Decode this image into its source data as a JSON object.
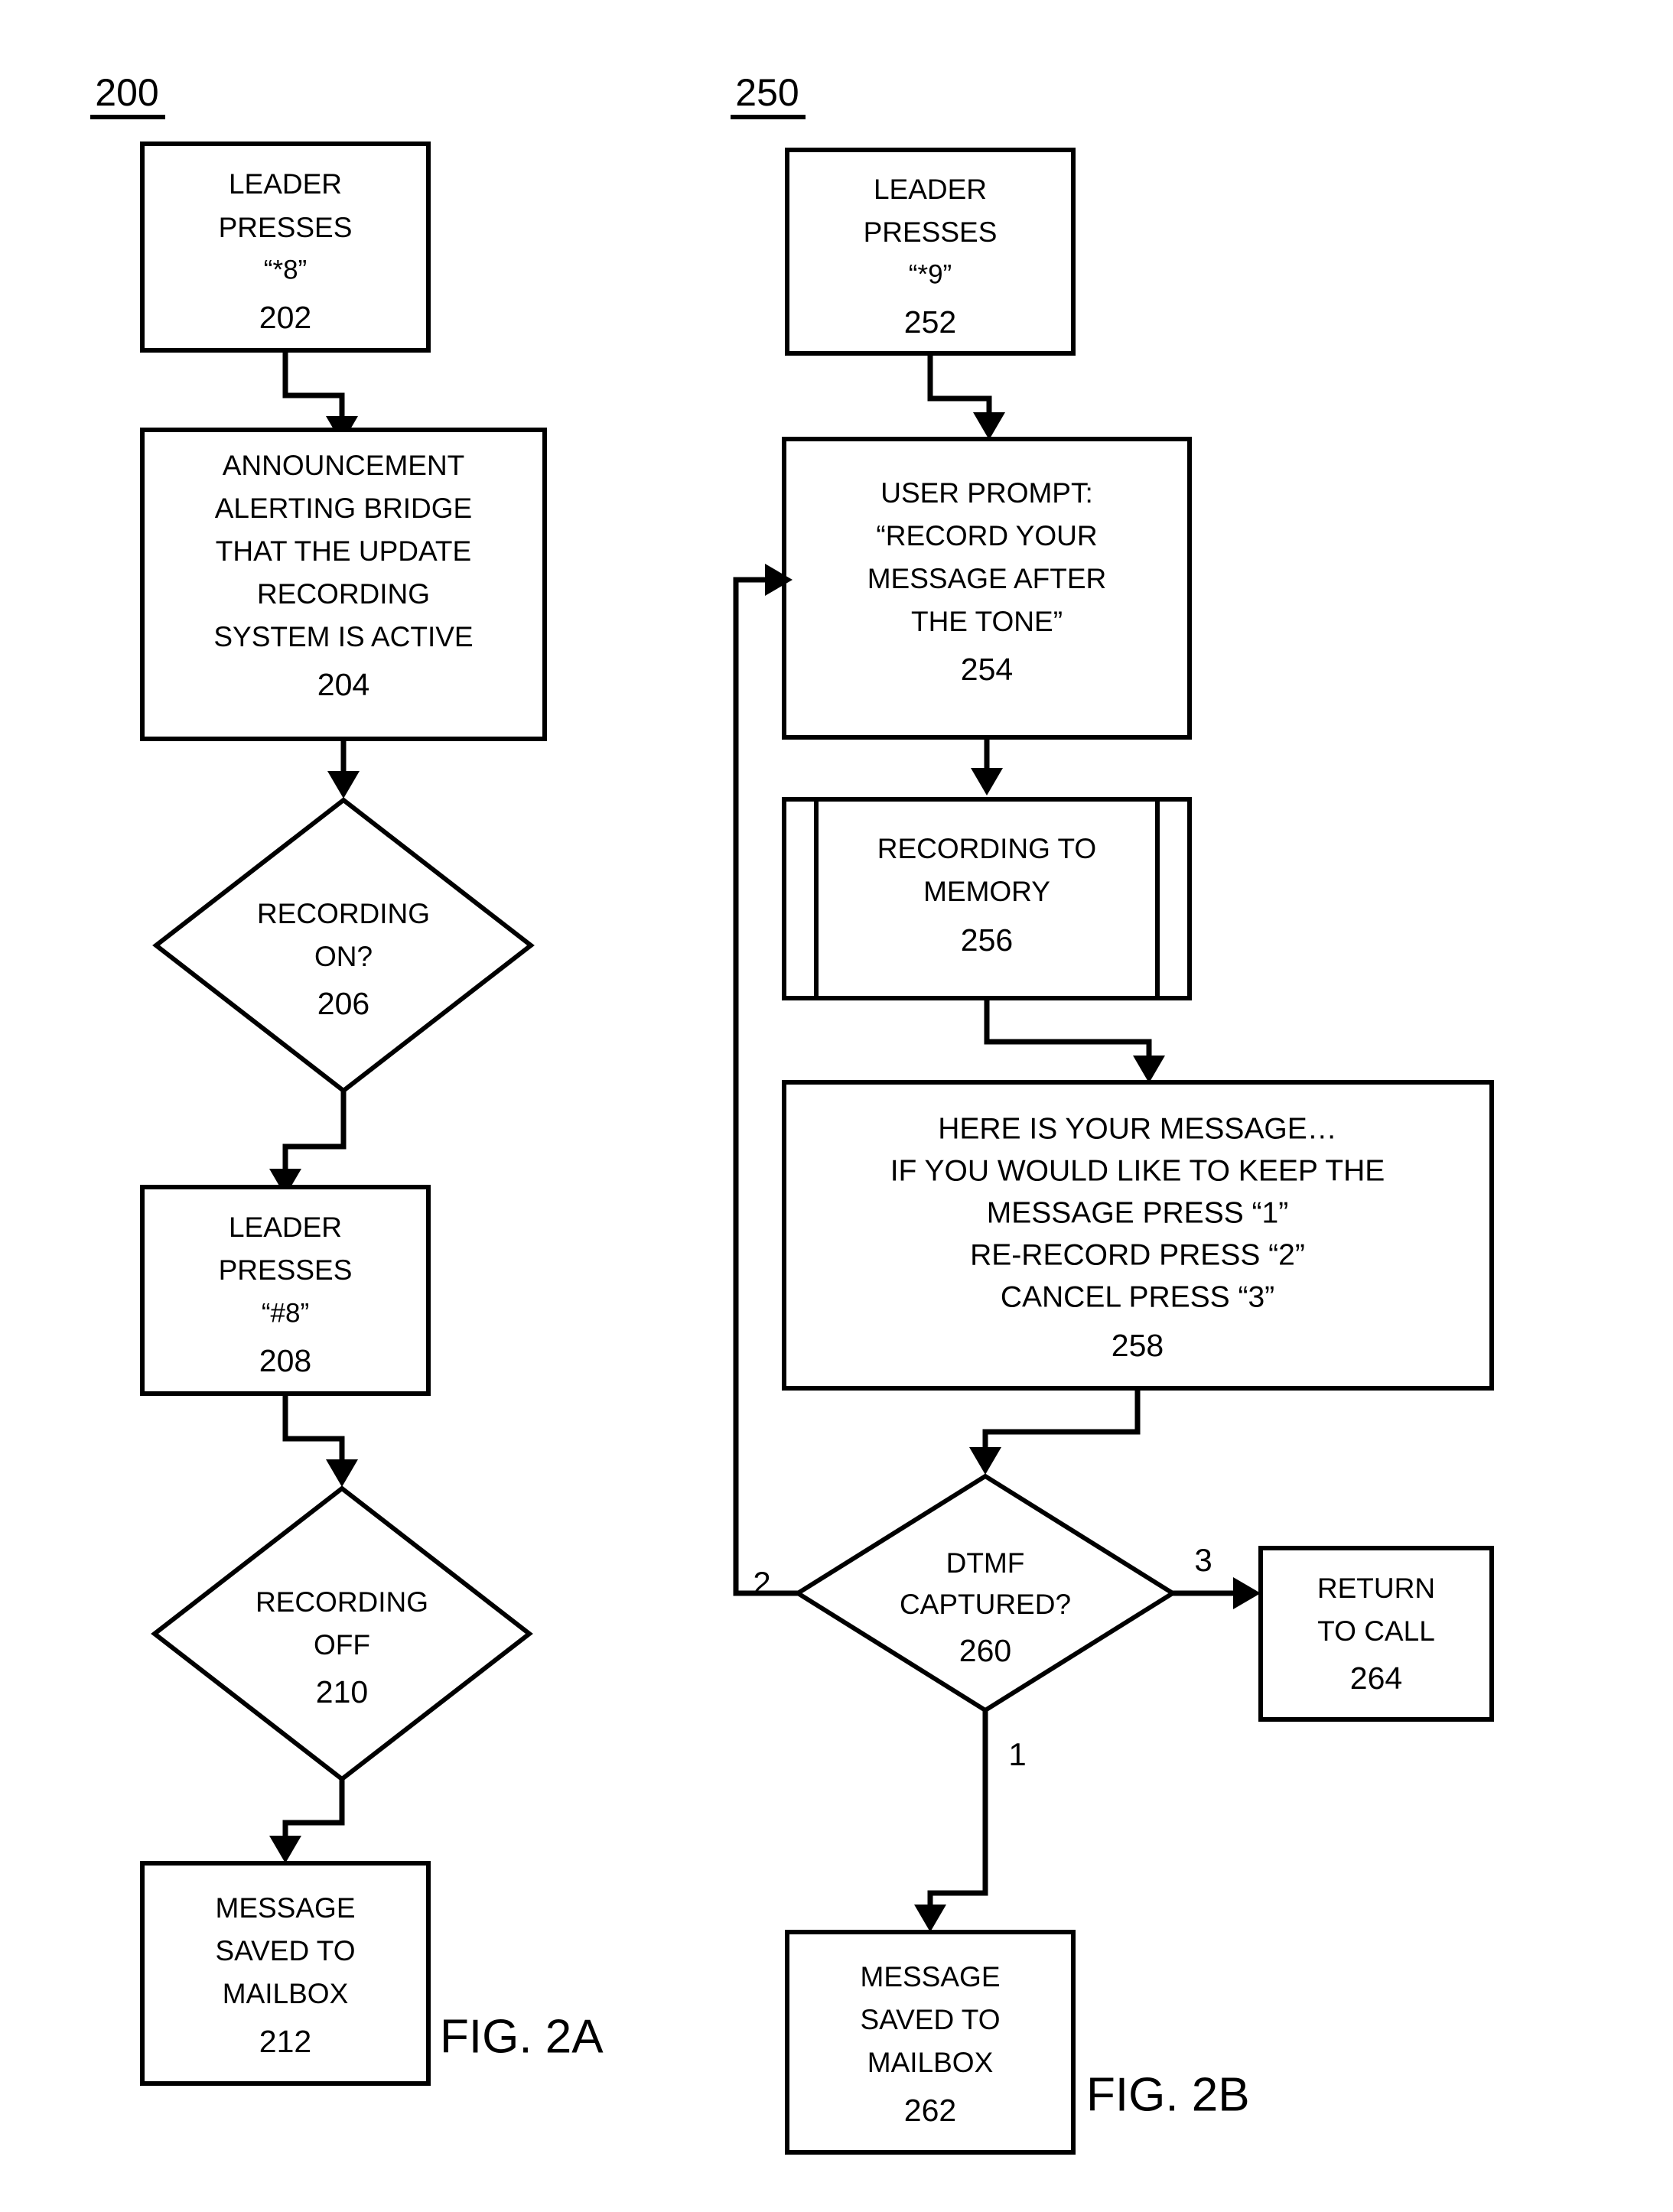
{
  "figures": [
    {
      "id": "fig-2a",
      "ref_label": "200",
      "caption": "FIG. 2A",
      "nodes": [
        {
          "id": "202",
          "shape": "process",
          "lines": [
            "LEADER",
            "PRESSES",
            "“*8”"
          ],
          "ref": "202"
        },
        {
          "id": "204",
          "shape": "process",
          "lines": [
            "ANNOUNCEMENT",
            "ALERTING BRIDGE",
            "THAT THE UPDATE",
            "RECORDING",
            "SYSTEM IS ACTIVE"
          ],
          "ref": "204"
        },
        {
          "id": "206",
          "shape": "decision",
          "lines": [
            "RECORDING",
            "ON?"
          ],
          "ref": "206"
        },
        {
          "id": "208",
          "shape": "process",
          "lines": [
            "LEADER",
            "PRESSES",
            "“#8”"
          ],
          "ref": "208"
        },
        {
          "id": "210",
          "shape": "decision",
          "lines": [
            "RECORDING",
            "OFF"
          ],
          "ref": "210"
        },
        {
          "id": "212",
          "shape": "process",
          "lines": [
            "MESSAGE",
            "SAVED TO",
            "MAILBOX"
          ],
          "ref": "212"
        }
      ],
      "edge_labels": []
    },
    {
      "id": "fig-2b",
      "ref_label": "250",
      "caption": "FIG. 2B",
      "nodes": [
        {
          "id": "252",
          "shape": "process",
          "lines": [
            "LEADER",
            "PRESSES",
            "“*9”"
          ],
          "ref": "252"
        },
        {
          "id": "254",
          "shape": "process",
          "lines": [
            "USER PROMPT:",
            "“RECORD YOUR",
            "MESSAGE AFTER",
            "THE TONE”"
          ],
          "ref": "254"
        },
        {
          "id": "256",
          "shape": "predefined-process",
          "lines": [
            "RECORDING TO",
            "MEMORY"
          ],
          "ref": "256"
        },
        {
          "id": "258",
          "shape": "process",
          "lines": [
            "HERE IS YOUR MESSAGE…",
            "IF YOU WOULD LIKE TO KEEP THE",
            "MESSAGE PRESS “1”",
            "RE-RECORD PRESS “2”",
            "CANCEL PRESS “3”"
          ],
          "ref": "258"
        },
        {
          "id": "260",
          "shape": "decision",
          "lines": [
            "DTMF",
            "CAPTURED?"
          ],
          "ref": "260"
        },
        {
          "id": "262",
          "shape": "process",
          "lines": [
            "MESSAGE",
            "SAVED TO",
            "MAILBOX"
          ],
          "ref": "262"
        },
        {
          "id": "264",
          "shape": "process",
          "lines": [
            "RETURN",
            "TO CALL"
          ],
          "ref": "264"
        }
      ],
      "edge_labels": [
        {
          "id": "branch-2",
          "text": "2"
        },
        {
          "id": "branch-3",
          "text": "3"
        },
        {
          "id": "branch-1",
          "text": "1"
        }
      ]
    }
  ],
  "colors": {
    "ink": "#000000",
    "paper": "#ffffff"
  }
}
